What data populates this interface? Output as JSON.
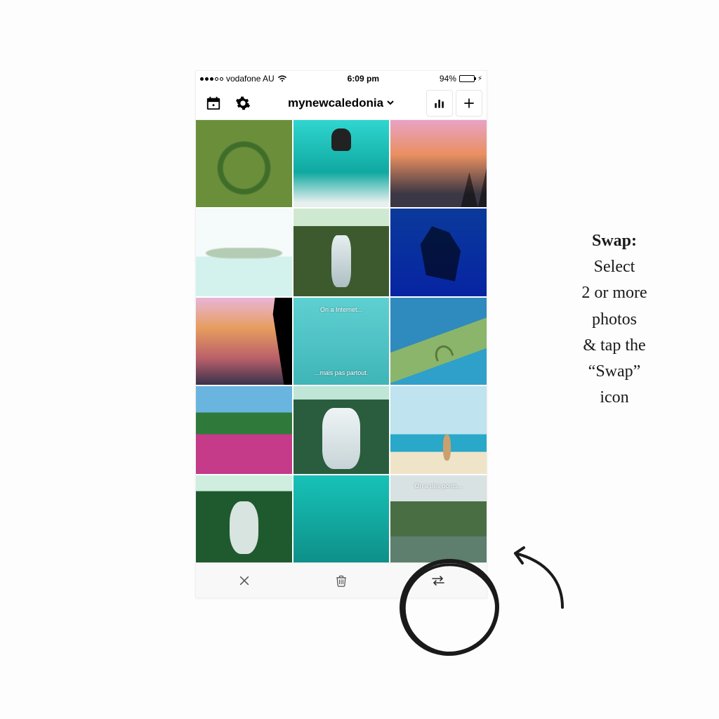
{
  "statusbar": {
    "carrier": "vodafone AU",
    "time": "6:09 pm",
    "battery_pct": "94%"
  },
  "header": {
    "username": "mynewcaledonia",
    "calendar_icon": "calendar-icon",
    "settings_icon": "gear-icon",
    "stats_icon": "bar-chart-icon",
    "add_icon": "plus-icon",
    "dropdown_icon": "chevron-down-icon"
  },
  "grid": {
    "tiles": [
      {
        "name": "heart-island-aerial"
      },
      {
        "name": "paddleboard-turquoise"
      },
      {
        "name": "pink-sunset-sailboat"
      },
      {
        "name": "pale-lagoon-palms",
        "faded": true
      },
      {
        "name": "jungle-waterfall"
      },
      {
        "name": "diver-bicycle-blue"
      },
      {
        "name": "palm-sunset-sky"
      },
      {
        "name": "turquoise-text-card",
        "caption_top": "On a Internet...",
        "caption_bottom": "...mais pas partout."
      },
      {
        "name": "heart-lagoon-aerial"
      },
      {
        "name": "pink-bougainvillea"
      },
      {
        "name": "river-rapids"
      },
      {
        "name": "beach-jump-person"
      },
      {
        "name": "dense-jungle-stream"
      },
      {
        "name": "teal-water-closeup"
      },
      {
        "name": "bridge-text-card",
        "caption_top": "On a des ponts..."
      }
    ]
  },
  "actionbar": {
    "close_icon": "close-icon",
    "delete_icon": "trash-icon",
    "swap_icon": "swap-icon"
  },
  "annotation": {
    "title": "Swap:",
    "line1": "Select",
    "line2": "2 or more",
    "line3": "photos",
    "line4": "& tap the",
    "line5": "“Swap”",
    "line6": "icon"
  }
}
